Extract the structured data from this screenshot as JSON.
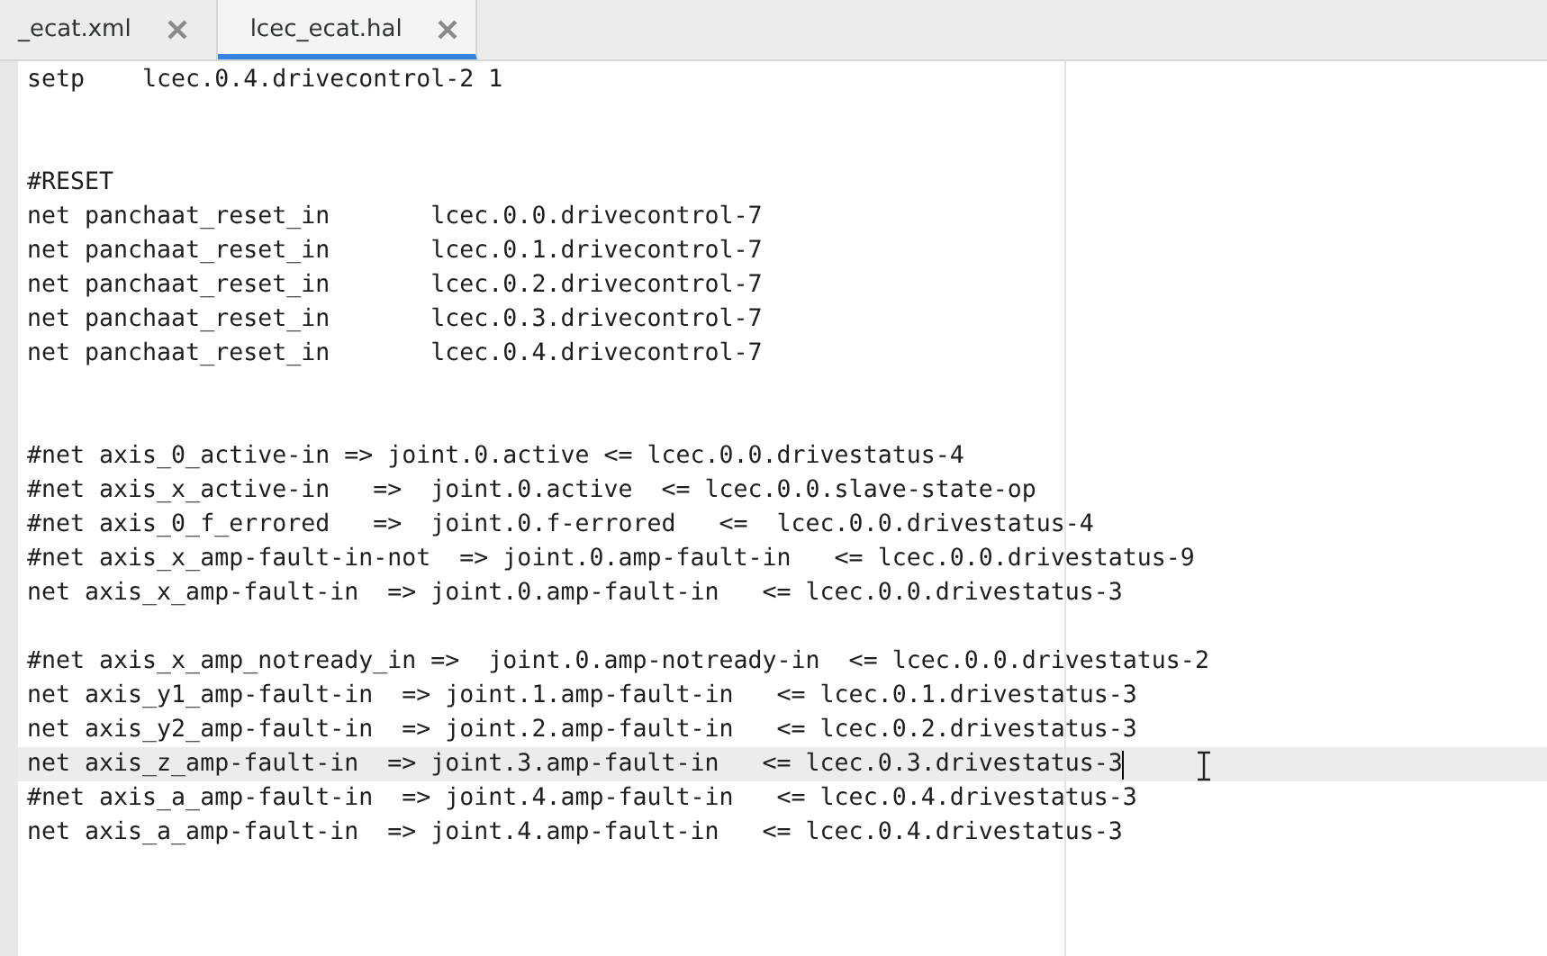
{
  "tabs": [
    {
      "label": "_ecat.xml",
      "selected": false
    },
    {
      "label": "lcec_ecat.hal",
      "selected": true
    }
  ],
  "editor": {
    "lines": [
      {
        "kind": "code",
        "text": "setp    lcec.0.4.drivecontrol-2 1",
        "current": false
      },
      {
        "kind": "blank",
        "current": false
      },
      {
        "kind": "blank",
        "current": false
      },
      {
        "kind": "code",
        "text": "#RESET",
        "current": false
      },
      {
        "kind": "code",
        "text": "net panchaat_reset_in       lcec.0.0.drivecontrol-7",
        "current": false
      },
      {
        "kind": "code",
        "text": "net panchaat_reset_in       lcec.0.1.drivecontrol-7",
        "current": false
      },
      {
        "kind": "code",
        "text": "net panchaat_reset_in       lcec.0.2.drivecontrol-7",
        "current": false
      },
      {
        "kind": "code",
        "text": "net panchaat_reset_in       lcec.0.3.drivecontrol-7",
        "current": false
      },
      {
        "kind": "code",
        "text": "net panchaat_reset_in       lcec.0.4.drivecontrol-7",
        "current": false
      },
      {
        "kind": "blank",
        "current": false
      },
      {
        "kind": "blank",
        "current": false
      },
      {
        "kind": "code",
        "text": "#net axis_0_active-in => joint.0.active <= lcec.0.0.drivestatus-4",
        "current": false
      },
      {
        "kind": "code",
        "text": "#net axis_x_active-in   =>  joint.0.active  <= lcec.0.0.slave-state-op",
        "current": false
      },
      {
        "kind": "code",
        "text": "#net axis_0_f_errored   =>  joint.0.f-errored   <=  lcec.0.0.drivestatus-4",
        "current": false
      },
      {
        "kind": "code",
        "text": "#net axis_x_amp-fault-in-not  => joint.0.amp-fault-in   <= lcec.0.0.drivestatus-9",
        "current": false
      },
      {
        "kind": "code",
        "text": "net axis_x_amp-fault-in  => joint.0.amp-fault-in   <= lcec.0.0.drivestatus-3",
        "current": false
      },
      {
        "kind": "blank",
        "current": false
      },
      {
        "kind": "code",
        "text": "#net axis_x_amp_notready_in =>  joint.0.amp-notready-in  <= lcec.0.0.drivestatus-2",
        "current": false
      },
      {
        "kind": "code",
        "text": "net axis_y1_amp-fault-in  => joint.1.amp-fault-in   <= lcec.0.1.drivestatus-3",
        "current": false
      },
      {
        "kind": "code",
        "text": "net axis_y2_amp-fault-in  => joint.2.amp-fault-in   <= lcec.0.2.drivestatus-3",
        "current": false
      },
      {
        "kind": "code",
        "text": "net axis_z_amp-fault-in  => joint.3.amp-fault-in   <= lcec.0.3.drivestatus-3",
        "current": true
      },
      {
        "kind": "code",
        "text": "#net axis_a_amp-fault-in  => joint.4.amp-fault-in   <= lcec.0.4.drivestatus-3",
        "current": false
      },
      {
        "kind": "code",
        "text": "net axis_a_amp-fault-in  => joint.4.amp-fault-in   <= lcec.0.4.drivestatus-3",
        "current": false
      }
    ]
  }
}
